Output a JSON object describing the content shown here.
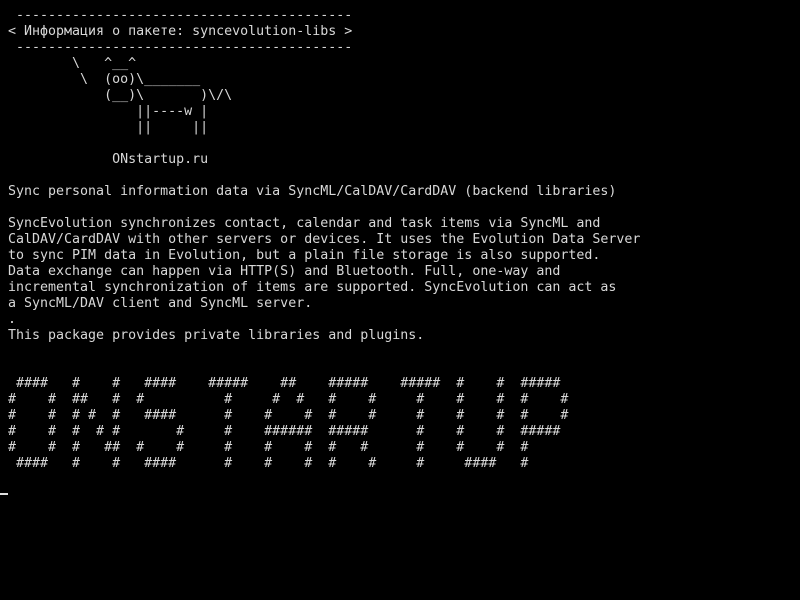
{
  "terminal": {
    "fg_color": "#d8d8d8",
    "bg_color": "#000000",
    "lines": [
      " ------------------------------------------",
      "< Информация о пакете: syncevolution-libs >",
      " ------------------------------------------",
      "        \\   ^__^",
      "         \\  (oo)\\_______",
      "            (__)\\       )\\/\\",
      "                ||----w |",
      "                ||     ||",
      "",
      "             ONstartup.ru",
      "",
      "Sync personal information data via SyncML/CalDAV/CardDAV (backend libraries)",
      "",
      "SyncEvolution synchronizes contact, calendar and task items via SyncML and",
      "CalDAV/CardDAV with other servers or devices. It uses the Evolution Data Server",
      "to sync PIM data in Evolution, but a plain file storage is also supported.",
      "Data exchange can happen via HTTP(S) and Bluetooth. Full, one-way and",
      "incremental synchronization of items are supported. SyncEvolution can act as",
      "a SyncML/DAV client and SyncML server.",
      ".",
      "This package provides private libraries and plugins.",
      "",
      "",
      " ####   #    #   ####    #####    ##    #####    #####  #    #  #####",
      "#    #  ##   #  #          #     #  #   #    #     #    #    #  #    #",
      "#    #  # #  #   ####      #    #    #  #    #     #    #    #  #    #",
      "#    #  #  # #       #     #    ######  #####      #    #    #  #####",
      "#    #  #   ##  #    #     #    #    #  #   #      #    #    #  #",
      " ####   #    #   ####      #    #    #  #    #     #     ####   #"
    ]
  }
}
